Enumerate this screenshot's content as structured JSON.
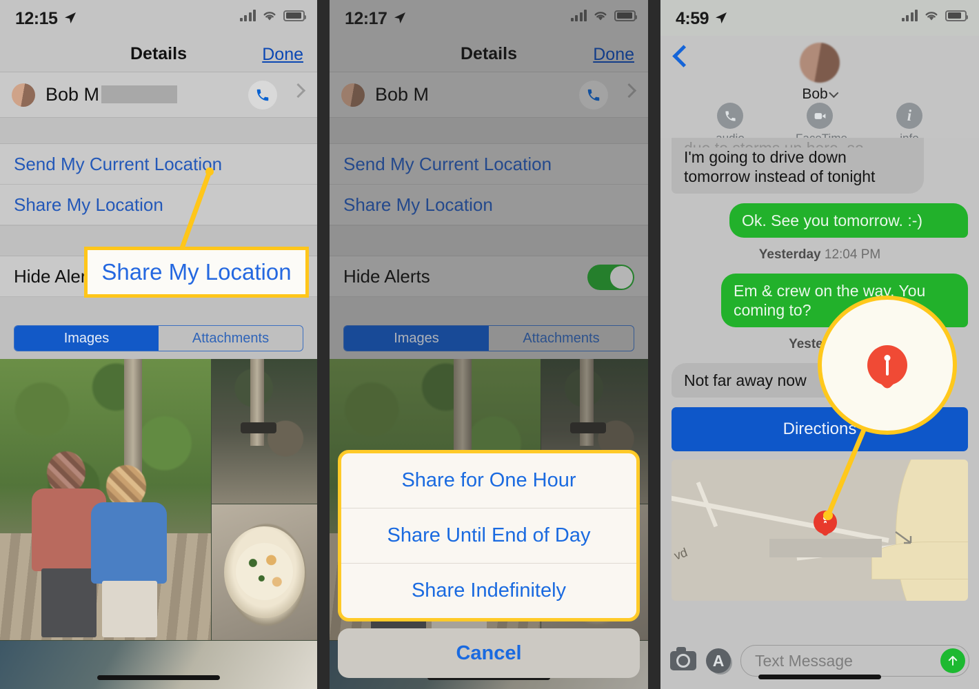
{
  "panels": [
    {
      "id": "details-redacted",
      "status": {
        "time": "12:15",
        "location_icon": "location-arrow-icon",
        "signal": "cellular-bars-icon",
        "wifi": "wifi-icon",
        "battery": "battery-icon"
      },
      "nav": {
        "title": "Details",
        "done": "Done"
      },
      "contact": {
        "name": "Bob M",
        "redacted": true,
        "call_icon": "phone-icon",
        "chevron": "chevron-right-icon"
      },
      "rows": [
        {
          "label": "Send My Current Location",
          "style": "link"
        },
        {
          "label": "Share My Location",
          "style": "link"
        },
        {
          "label": "Hide Alerts",
          "style": "plain",
          "toggle": false
        }
      ],
      "segmented": {
        "options": [
          "Images",
          "Attachments"
        ],
        "selected": "Images"
      },
      "callout": {
        "text": "Share My Location",
        "border_color": "#ffc61a",
        "text_color": "#2468e0"
      }
    },
    {
      "id": "details-sheet",
      "status": {
        "time": "12:17",
        "location_icon": "location-arrow-icon",
        "signal": "cellular-bars-icon",
        "wifi": "wifi-icon",
        "battery": "battery-icon"
      },
      "nav": {
        "title": "Details",
        "done": "Done"
      },
      "contact": {
        "name": "Bob M",
        "redacted": false,
        "call_icon": "phone-icon",
        "chevron": "chevron-right-icon"
      },
      "rows": [
        {
          "label": "Send My Current Location",
          "style": "link"
        },
        {
          "label": "Share My Location",
          "style": "link"
        },
        {
          "label": "Hide Alerts",
          "style": "plain",
          "toggle": true
        }
      ],
      "segmented": {
        "options": [
          "Images",
          "Attachments"
        ],
        "selected": "Images"
      },
      "action_sheet": {
        "items": [
          "Share for One Hour",
          "Share Until End of Day",
          "Share Indefinitely"
        ],
        "cancel": "Cancel",
        "highlight_color": "#ffca28"
      }
    },
    {
      "id": "messages-thread",
      "status": {
        "time": "4:59",
        "location_icon": "location-arrow-icon",
        "signal": "cellular-bars-icon",
        "wifi": "wifi-icon",
        "battery": "battery-icon"
      },
      "header": {
        "back_icon": "chevron-left-icon",
        "contact_name": "Bob",
        "contact_chevron": "chevron-down-icon",
        "actions": [
          {
            "label": "audio",
            "icon": "phone-icon"
          },
          {
            "label": "FaceTime",
            "icon": "video-camera-icon"
          },
          {
            "label": "info",
            "icon": "info-icon"
          }
        ]
      },
      "messages": [
        {
          "from": "them",
          "text": "due to storms up here, so",
          "clipped": true
        },
        {
          "from": "them",
          "text": "I'm going to drive down tomorrow instead of tonight",
          "continues": true
        },
        {
          "from": "me",
          "text": "Ok. See you tomorrow. :-)"
        },
        {
          "type": "timestamp",
          "prefix": "Yesterday",
          "time": "12:04 PM"
        },
        {
          "from": "me",
          "text": "Em & crew on the way. You coming to?"
        },
        {
          "type": "timestamp",
          "prefix": "Yesterday",
          "time": ""
        },
        {
          "from": "them",
          "text": "Not far away now"
        }
      ],
      "directions_button": "Directions",
      "map": {
        "pin_icon": "map-pin-icon",
        "street_label": "vd",
        "redacted_label": true
      },
      "input_bar": {
        "camera_icon": "camera-icon",
        "appstore_icon": "app-store-icon",
        "placeholder": "Text Message",
        "send_icon": "send-arrow-up-icon"
      },
      "magnifier": {
        "icon": "map-pin-icon",
        "border_color": "#ffc81c",
        "pin_color": "#f04a35"
      }
    }
  ],
  "colors": {
    "annotation_yellow": "#ffc61a",
    "link_blue": "#2358b8",
    "ios_blue": "#1a6ae0",
    "sms_green": "#22b12b",
    "button_blue": "#0e57c9",
    "toggle_green": "#24a52f",
    "pin_red": "#e8392c"
  }
}
